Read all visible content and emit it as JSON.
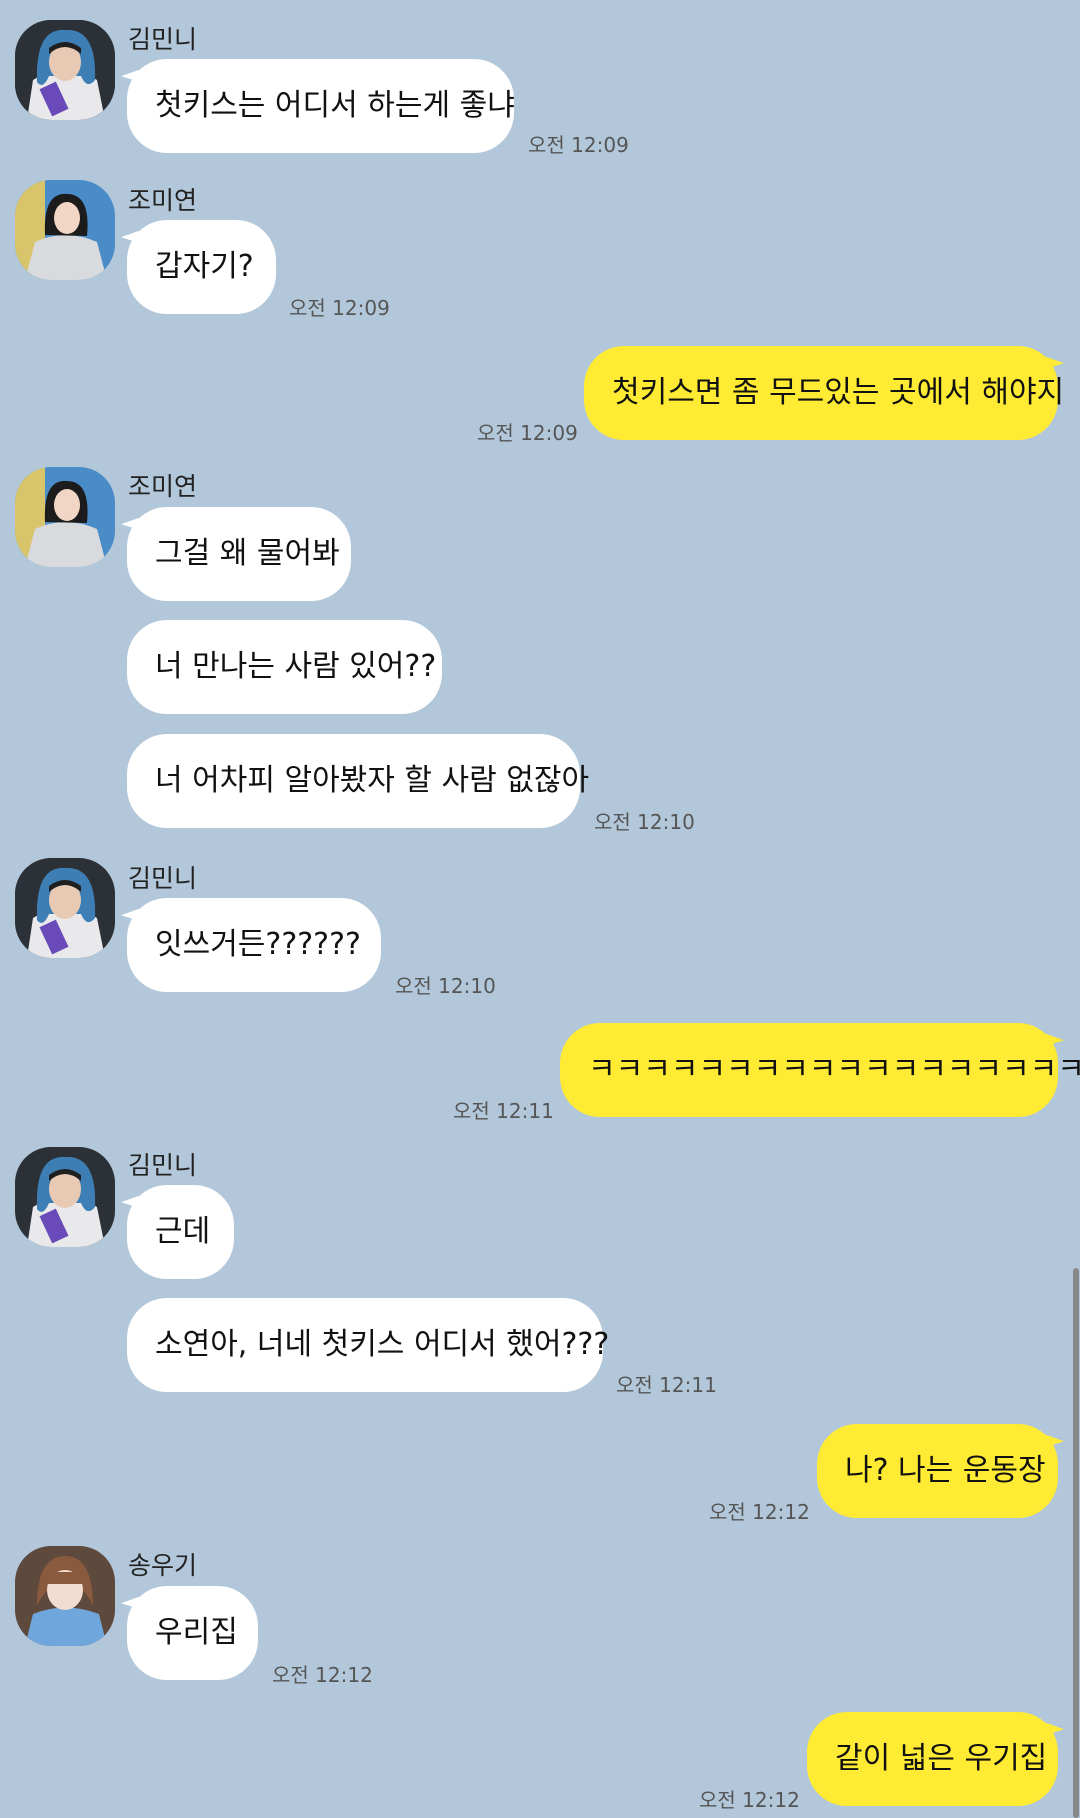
{
  "messages": [
    {
      "sender": "김민니",
      "text": "첫키스는 어디서 하는게 좋냐",
      "time": "오전 12:09"
    },
    {
      "sender": "조미연",
      "text": "갑자기?",
      "time": "오전 12:09"
    },
    {
      "text": "첫키스면 좀 무드있는 곳에서 해야지",
      "time": "오전 12:09"
    },
    {
      "sender": "조미연",
      "text": "그걸 왜 물어봐"
    },
    {
      "text": "너 만나는 사람 있어??"
    },
    {
      "text": "너 어차피 알아봤자 할 사람 없잖아",
      "time": "오전 12:10"
    },
    {
      "sender": "김민니",
      "text": "잇쓰거든??????",
      "time": "오전 12:10"
    },
    {
      "text": "ㅋㅋㅋㅋㅋㅋㅋㅋㅋㅋㅋㅋㅋㅋㅋㅋㅋㅋ",
      "time": "오전 12:11"
    },
    {
      "sender": "김민니",
      "text": "근데"
    },
    {
      "text": "소연아, 너네 첫키스 어디서 했어???",
      "time": "오전 12:11"
    },
    {
      "text": "나? 나는 운동장",
      "time": "오전 12:12"
    },
    {
      "sender": "송우기",
      "text": "우리집",
      "time": "오전 12:12"
    },
    {
      "text": "같이 넓은 우기집",
      "time": "오전 12:12"
    }
  ],
  "colors": {
    "background": "#b2c7da",
    "incoming": "#ffffff",
    "outgoing": "#ffeb33"
  }
}
